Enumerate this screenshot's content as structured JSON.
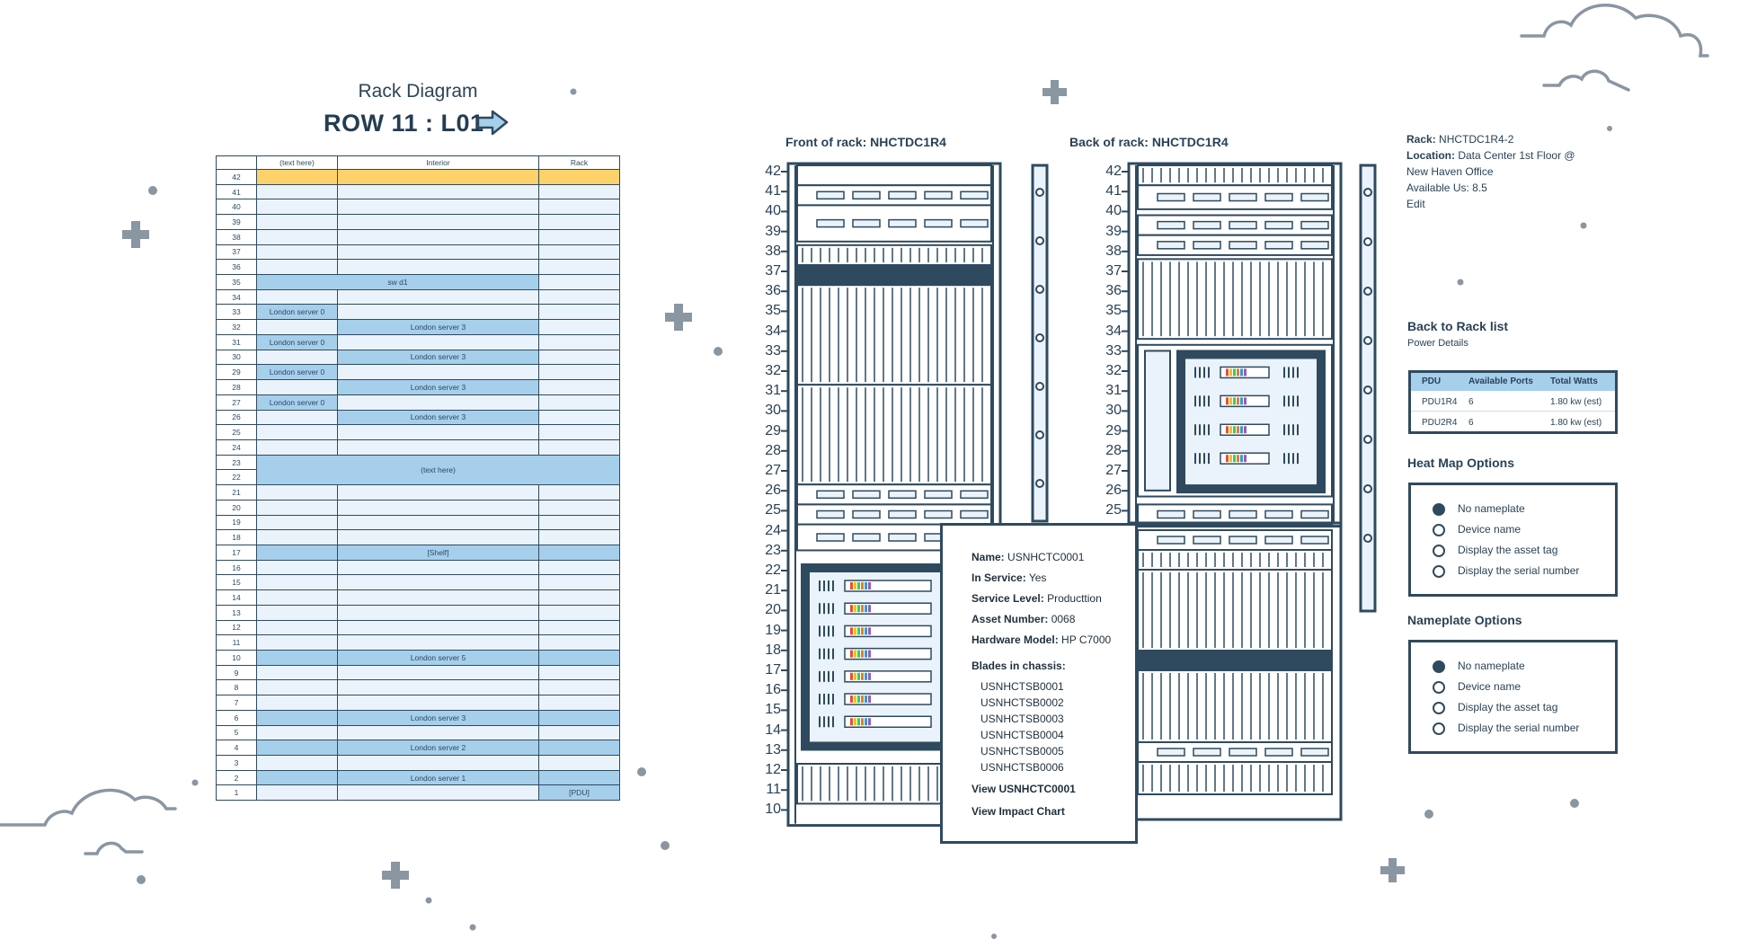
{
  "header": {
    "subtitle": "Rack Diagram",
    "title": "ROW 11 : L01"
  },
  "table": {
    "columns": [
      "(text here)",
      "Interior",
      "Rack"
    ],
    "units": [
      "42",
      "41",
      "40",
      "39",
      "38",
      "37",
      "36",
      "35",
      "34",
      "33",
      "32",
      "31",
      "30",
      "29",
      "28",
      "27",
      "26",
      "25",
      "24",
      "23",
      "22",
      "21",
      "20",
      "19",
      "18",
      "17",
      "16",
      "15",
      "14",
      "13",
      "12",
      "11",
      "10",
      "9",
      "8",
      "7",
      "6",
      "5",
      "4",
      "3",
      "2",
      "1"
    ],
    "labels": {
      "sw_d1": "sw d1",
      "london_server_0": "London server 0",
      "london_server_3": "London server 3",
      "text_here": "(text here)",
      "shelf": "[Shelf]",
      "london_server_5": "London server 5",
      "london_server_2": "London server 2",
      "london_server_1": "London server 1",
      "pdu": "[PDU]"
    }
  },
  "front_rack": {
    "title": "Front of rack: NHCTDC1R4",
    "units": [
      "42",
      "41",
      "40",
      "39",
      "38",
      "37",
      "36",
      "35",
      "34",
      "33",
      "32",
      "31",
      "30",
      "29",
      "28",
      "27",
      "26",
      "25",
      "24",
      "23",
      "22",
      "21",
      "20",
      "19",
      "18",
      "17",
      "16",
      "15",
      "14",
      "13",
      "12",
      "11",
      "10"
    ]
  },
  "back_rack": {
    "title": "Back of rack: NHCTDC1R4",
    "units": [
      "42",
      "41",
      "40",
      "39",
      "38",
      "37",
      "36",
      "35",
      "34",
      "33",
      "32",
      "31",
      "30",
      "29",
      "28",
      "27",
      "26",
      "25"
    ]
  },
  "popup": {
    "name_label": "Name:",
    "name": "USNHCTC0001",
    "service_label": "In Service:",
    "service": "Yes",
    "level_label": "Service Level:",
    "level": "Producttion",
    "asset_label": "Asset Number:",
    "asset": "0068",
    "model_label": "Hardware Model:",
    "model": "HP C7000",
    "blades_label": "Blades in chassis:",
    "blades": [
      "USNHCTSB0001",
      "USNHCTSB0002",
      "USNHCTSB0003",
      "USNHCTSB0004",
      "USNHCTSB0005",
      "USNHCTSB0006"
    ],
    "view_link": "View USNHCTC0001",
    "impact_link": "View Impact Chart"
  },
  "rack_info": {
    "rack_label": "Rack:",
    "rack": "NHCTDC1R4-2",
    "location_label": "Location:",
    "location_1": "Data Center 1st Floor @",
    "location_2": "New Haven Office",
    "available": "Available Us: 8.5",
    "edit": "Edit"
  },
  "back_link": "Back to Rack list",
  "power_details": "Power Details",
  "pdu_table": {
    "headers": [
      "PDU",
      "Available Ports",
      "Total Watts"
    ],
    "rows": [
      {
        "pdu": "PDU1R4",
        "ports": "6",
        "watts": "1.80 kw (est)"
      },
      {
        "pdu": "PDU2R4",
        "ports": "6",
        "watts": "1.80 kw (est)"
      }
    ]
  },
  "heatmap": {
    "heading": "Heat Map Options",
    "options": [
      "No nameplate",
      "Device name",
      "Display the asset tag",
      "Display the serial number"
    ],
    "selected": 0
  },
  "nameplate": {
    "heading": "Nameplate Options",
    "options": [
      "No nameplate",
      "Device name",
      "Display the asset tag",
      "Display the serial number"
    ],
    "selected": 0
  },
  "colors": {
    "stroke": "#2f4a5f",
    "blue": "#a6cfec",
    "light": "#eaf3fb",
    "yellow": "#fdd26b"
  }
}
